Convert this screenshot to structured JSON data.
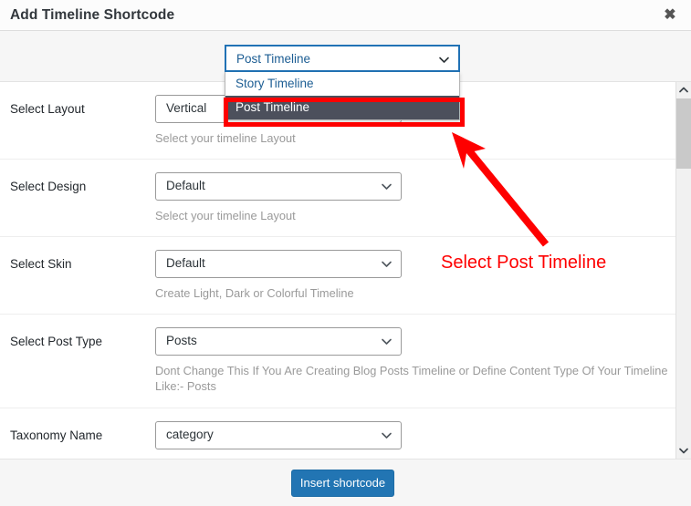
{
  "titlebar": {
    "title": "Add Timeline Shortcode",
    "close_label": "✖"
  },
  "timeline_type_dropdown": {
    "selected_value": "Post Timeline",
    "options": [
      "Story Timeline",
      "Post Timeline"
    ],
    "highlighted_option": "Post Timeline",
    "open": true,
    "border_color": "#2172b5",
    "highlight_bg": "#4c505c"
  },
  "form": {
    "rows": [
      {
        "label": "Select Layout",
        "value": "Vertical",
        "help": "Select your timeline Layout"
      },
      {
        "label": "Select Design",
        "value": "Default",
        "help": "Select your timeline Layout"
      },
      {
        "label": "Select Skin",
        "value": "Default",
        "help": "Create Light, Dark or Colorful Timeline"
      },
      {
        "label": "Select Post Type",
        "value": "Posts",
        "help": "Dont Change This If You Are Creating Blog Posts Timeline or Define Content Type Of Your Timeline Like:- Posts"
      },
      {
        "label": "Taxonomy Name",
        "value": "category",
        "help": ""
      }
    ]
  },
  "footer": {
    "insert_button": "Insert shortcode",
    "button_color": "#2275b3"
  },
  "scrollbar": {
    "up_arrow": "▲",
    "down_arrow": "▼"
  },
  "annotation": {
    "text": "Select Post Timeline",
    "color": "#fe0000"
  }
}
